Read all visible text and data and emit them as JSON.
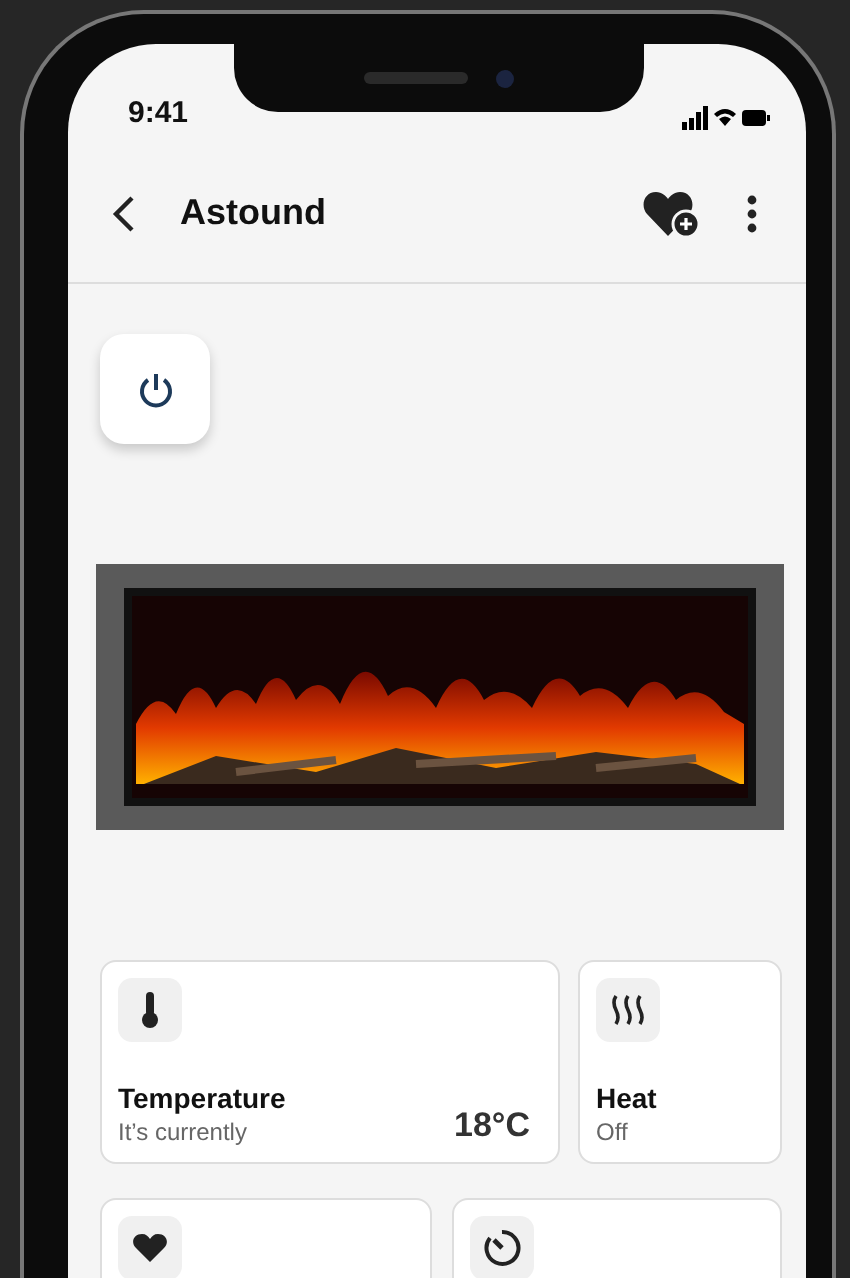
{
  "status_bar": {
    "time": "9:41"
  },
  "header": {
    "title": "Astound"
  },
  "tiles": [
    {
      "kind": "temperature",
      "title": "Temperature",
      "subtitle": "It’s currently",
      "value": "18°C"
    },
    {
      "kind": "heat",
      "title": "Heat",
      "subtitle": "Off"
    }
  ],
  "more_tiles": [
    {
      "kind": "favorite"
    },
    {
      "kind": "timer"
    }
  ]
}
